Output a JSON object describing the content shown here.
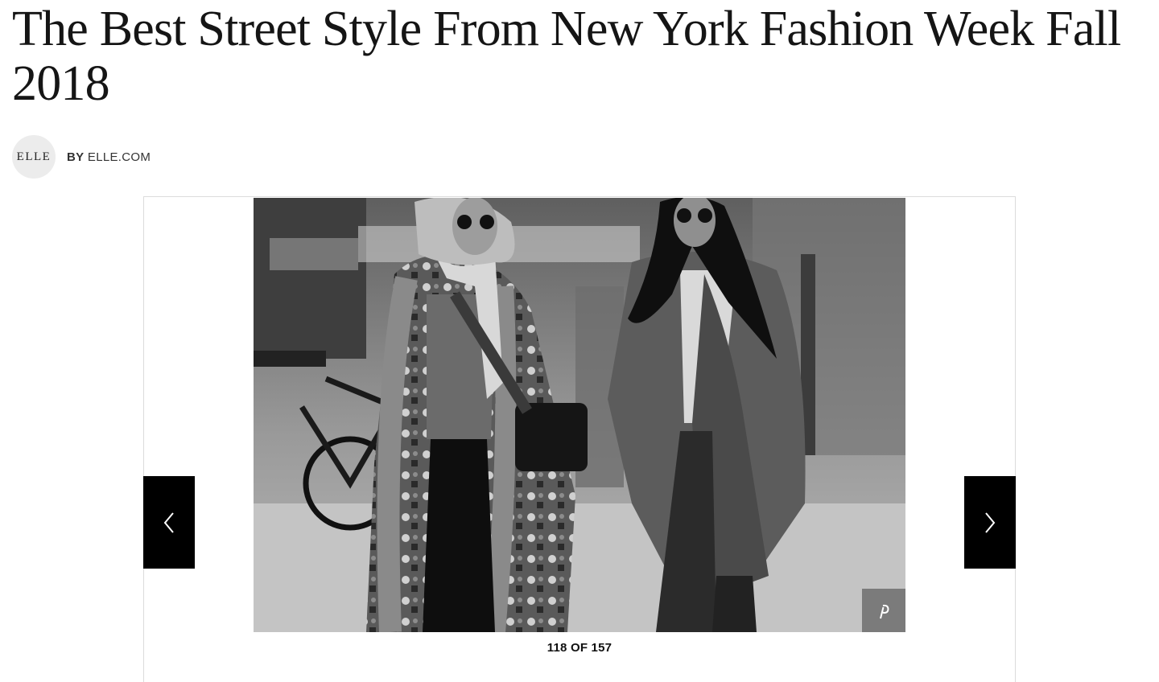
{
  "article": {
    "title": "The Best Street Style From New York Fashion Week Fall 2018"
  },
  "byline": {
    "logo_text": "ELLE",
    "by": "BY",
    "author": "ELLE.COM"
  },
  "gallery": {
    "counter": "118 OF 157",
    "prev_icon": "chevron-left-icon",
    "next_icon": "chevron-right-icon",
    "share_icon": "pinterest-icon"
  },
  "colors": {
    "nav_button": "#000000",
    "pin_button": "#6e6e6e",
    "headline": "#151515"
  }
}
